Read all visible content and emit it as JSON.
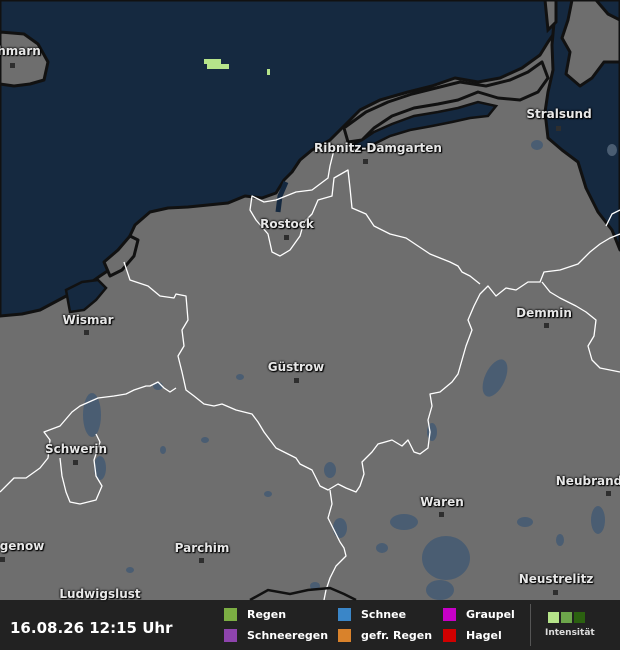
{
  "colors": {
    "sea": "#152940",
    "land": "#6e6e6e",
    "lake": "#4a5d72",
    "border": "#ffffff",
    "coast": "#111111",
    "rain_cell": "#b6e48a"
  },
  "cities": [
    {
      "key": "fehmarn",
      "label": "hmarn"
    },
    {
      "key": "stralsund",
      "label": "Stralsund"
    },
    {
      "key": "ribnitz",
      "label": "Ribnitz-Damgarten"
    },
    {
      "key": "rostock",
      "label": "Rostock"
    },
    {
      "key": "wismar",
      "label": "Wismar"
    },
    {
      "key": "demmin",
      "label": "Demmin"
    },
    {
      "key": "guestrow",
      "label": "Güstrow"
    },
    {
      "key": "schwerin",
      "label": "Schwerin"
    },
    {
      "key": "neubrandenburg",
      "label": "Neubrand"
    },
    {
      "key": "waren",
      "label": "Waren"
    },
    {
      "key": "grevesmuehlen",
      "label": "genow"
    },
    {
      "key": "parchim",
      "label": "Parchim"
    },
    {
      "key": "neustrelitz",
      "label": "Neustrelitz"
    },
    {
      "key": "ludwigslust",
      "label": "Ludwigslust"
    }
  ],
  "footer": {
    "timestamp": "16.08.26 12:15 Uhr",
    "legend": [
      {
        "key": "regen",
        "label": "Regen",
        "color": "#7cae43"
      },
      {
        "key": "schneeregen",
        "label": "Schneeregen",
        "color": "#8e44ad"
      },
      {
        "key": "schnee",
        "label": "Schnee",
        "color": "#3a86c8"
      },
      {
        "key": "gefr_regen",
        "label": "gefr. Regen",
        "color": "#d9822b"
      },
      {
        "key": "graupel",
        "label": "Graupel",
        "color": "#c800c8"
      },
      {
        "key": "hagel",
        "label": "Hagel",
        "color": "#d10000"
      }
    ],
    "intensity_label": "Intensität",
    "intensity_colors": [
      "#b6e48a",
      "#6da64b",
      "#2b6110"
    ]
  }
}
